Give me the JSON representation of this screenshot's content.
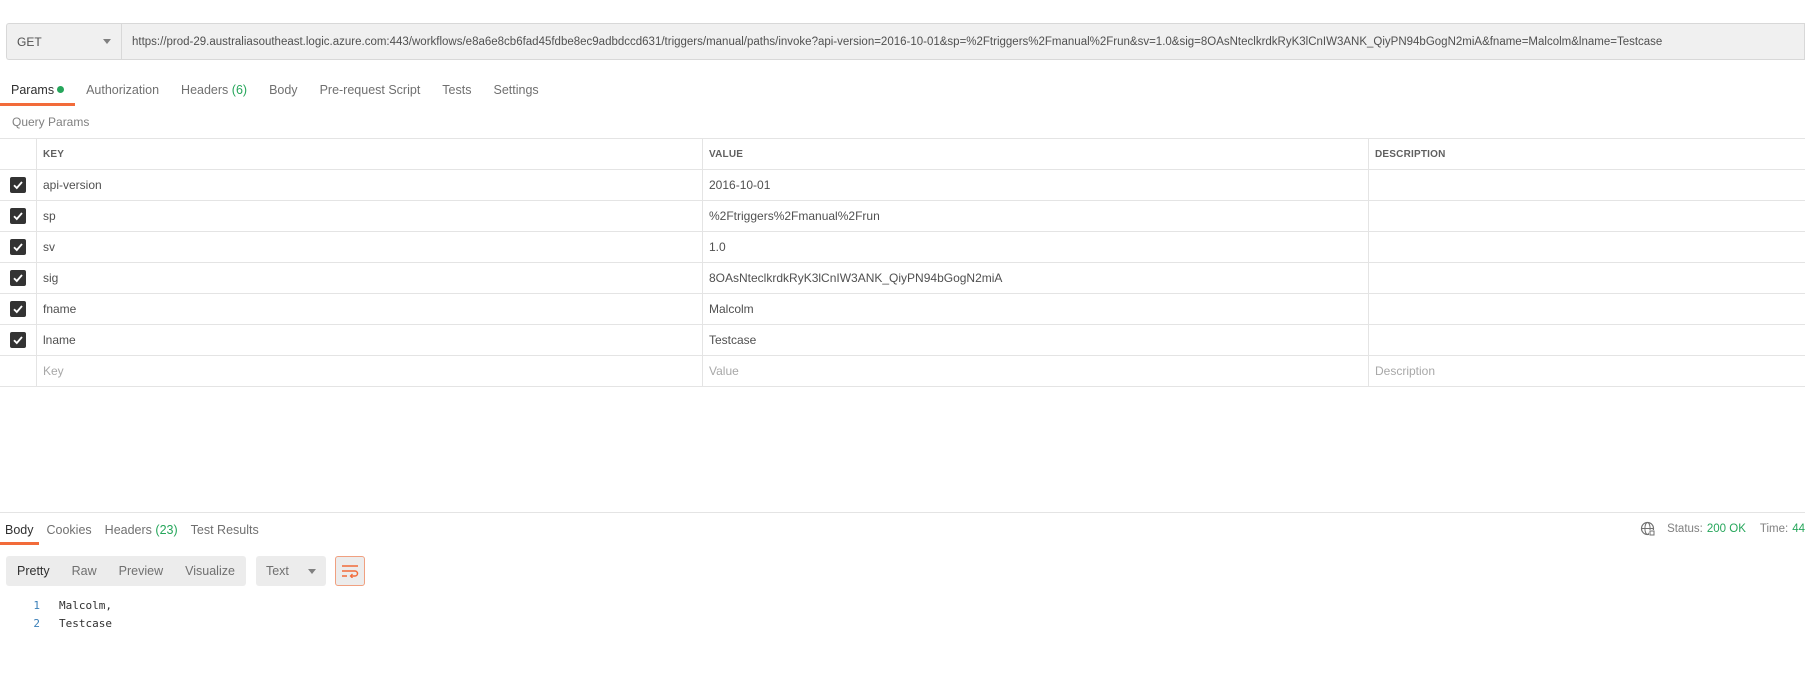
{
  "request": {
    "method": "GET",
    "url": "https://prod-29.australiasoutheast.logic.azure.com:443/workflows/e8a6e8cb6fad45fdbe8ec9adbdccd631/triggers/manual/paths/invoke?api-version=2016-10-01&sp=%2Ftriggers%2Fmanual%2Frun&sv=1.0&sig=8OAsNteclkrdkRyK3lCnIW3ANK_QiyPN94bGogN2miA&fname=Malcolm&lname=Testcase"
  },
  "request_tabs": [
    {
      "label": "Params"
    },
    {
      "label": "Authorization"
    },
    {
      "label": "Headers",
      "count": "(6)"
    },
    {
      "label": "Body"
    },
    {
      "label": "Pre-request Script"
    },
    {
      "label": "Tests"
    },
    {
      "label": "Settings"
    }
  ],
  "query_params": {
    "title": "Query Params",
    "columns": {
      "key": "KEY",
      "value": "VALUE",
      "description": "DESCRIPTION"
    },
    "rows": [
      {
        "key": "api-version",
        "value": "2016-10-01",
        "checked": true
      },
      {
        "key": "sp",
        "value": "%2Ftriggers%2Fmanual%2Frun",
        "checked": true
      },
      {
        "key": "sv",
        "value": "1.0",
        "checked": true
      },
      {
        "key": "sig",
        "value": "8OAsNteclkrdkRyK3lCnIW3ANK_QiyPN94bGogN2miA",
        "checked": true
      },
      {
        "key": "fname",
        "value": "Malcolm",
        "checked": true
      },
      {
        "key": "lname",
        "value": "Testcase",
        "checked": true
      }
    ],
    "new_row": {
      "key_placeholder": "Key",
      "value_placeholder": "Value",
      "description_placeholder": "Description"
    }
  },
  "response_tabs": [
    {
      "label": "Body"
    },
    {
      "label": "Cookies"
    },
    {
      "label": "Headers",
      "count": "(23)"
    },
    {
      "label": "Test Results"
    }
  ],
  "status": {
    "status_label": "Status:",
    "status_value": "200 OK",
    "time_label": "Time:",
    "time_value": "44"
  },
  "view_modes": [
    "Pretty",
    "Raw",
    "Preview",
    "Visualize"
  ],
  "format": "Text",
  "code_lines": [
    {
      "n": "1",
      "text": "Malcolm,"
    },
    {
      "n": "2",
      "text": "Testcase"
    }
  ],
  "colors": {
    "accent": "#f26b3a",
    "success": "#26a65b",
    "line_number": "#3a7fb8"
  },
  "icons": [
    "chevron-down-icon",
    "checkbox-checked-icon",
    "globe-icon",
    "wrap-lines-icon"
  ]
}
